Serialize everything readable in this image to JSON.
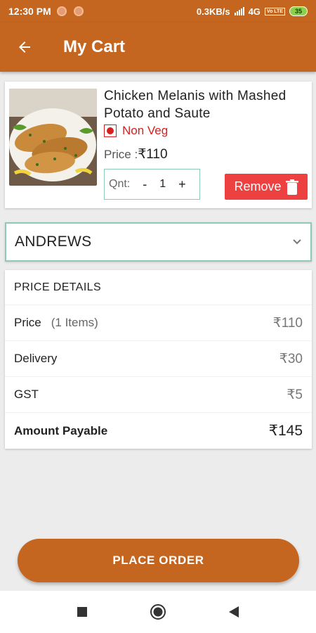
{
  "status_bar": {
    "time": "12:30 PM",
    "network_speed": "0.3KB/s",
    "network_type": "4G",
    "volte": "Vo LTE",
    "battery": "35"
  },
  "app_bar": {
    "title": "My Cart",
    "back_icon": "arrow-left-icon"
  },
  "cart_item": {
    "name": "Chicken Melanis with Mashed Potato and Saute",
    "veg_type": "Non Veg",
    "price_label": "Price :",
    "price_value": "₹110",
    "qty_label": "Qnt:",
    "qty_minus": "-",
    "qty_value": "1",
    "qty_plus": "+",
    "remove_label": "Remove"
  },
  "address": {
    "selected": "ANDREWS"
  },
  "price_details": {
    "header": "PRICE DETAILS",
    "rows": [
      {
        "label": "Price",
        "note": "(1 Items)",
        "value": "₹110"
      },
      {
        "label": "Delivery",
        "note": "",
        "value": "₹30"
      },
      {
        "label": "GST",
        "note": "",
        "value": "₹5"
      },
      {
        "label": "Amount Payable",
        "note": "",
        "value": "₹145"
      }
    ]
  },
  "place_order_label": "PLACE ORDER",
  "colors": {
    "primary": "#c4661f",
    "remove": "#ec4140",
    "non_veg": "#d81f1f",
    "accent_border": "#8fc9b8"
  }
}
